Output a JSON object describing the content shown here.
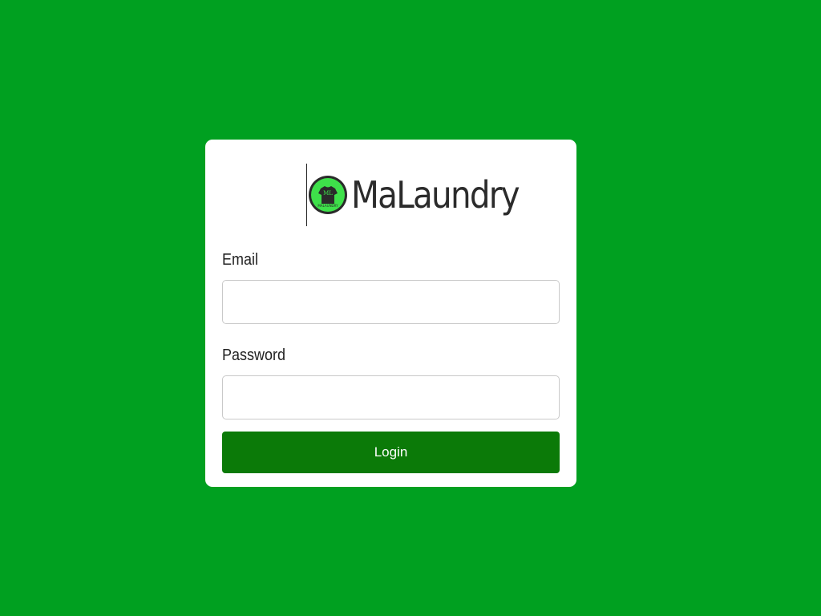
{
  "brand": {
    "name": "MaLaundry",
    "logo_text_top": "ML",
    "logo_text_bottom": "MALAUNDRY",
    "logo_color": "#3ee04a"
  },
  "form": {
    "email_label": "Email",
    "email_value": "",
    "password_label": "Password",
    "password_value": "",
    "login_label": "Login"
  },
  "colors": {
    "background": "#00a020",
    "button": "#0b7a08",
    "card": "#ffffff"
  }
}
